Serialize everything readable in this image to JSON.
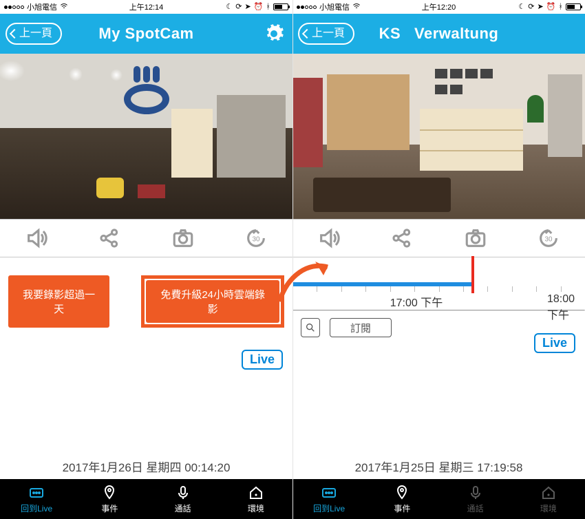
{
  "screens": [
    {
      "status": {
        "carrier": "小旭電信",
        "time": "上午12:14"
      },
      "nav": {
        "back": "上一頁",
        "title": "My SpotCam",
        "settings": true
      },
      "actions": [
        "speaker-icon",
        "share-icon",
        "camera-icon",
        "rewind-30-icon"
      ],
      "promo": {
        "btn1": "我要錄影超過一天",
        "btn2": "免費升級24小時雲端錄影"
      },
      "live_label": "Live",
      "timestamp": "2017年1月26日 星期四 00:14:20",
      "tabs": [
        {
          "label": "回到Live",
          "state": "on"
        },
        {
          "label": "事件",
          "state": "off"
        },
        {
          "label": "通話",
          "state": "off"
        },
        {
          "label": "環境",
          "state": "off"
        }
      ]
    },
    {
      "status": {
        "carrier": "小旭電信",
        "time": "上午12:20"
      },
      "nav": {
        "back": "上一頁",
        "title": "KS   Verwaltung",
        "settings": false
      },
      "actions": [
        "speaker-icon",
        "share-icon",
        "camera-icon",
        "rewind-30-icon"
      ],
      "timeline": {
        "ticks": [
          "17:00 下午",
          "18:00 下午"
        ]
      },
      "subscribe": {
        "label": "訂閱"
      },
      "live_label": "Live",
      "timestamp": "2017年1月25日 星期三 17:19:58",
      "tabs": [
        {
          "label": "回到Live",
          "state": "on"
        },
        {
          "label": "事件",
          "state": "off"
        },
        {
          "label": "通話",
          "state": "dis"
        },
        {
          "label": "環境",
          "state": "dis"
        }
      ]
    }
  ]
}
